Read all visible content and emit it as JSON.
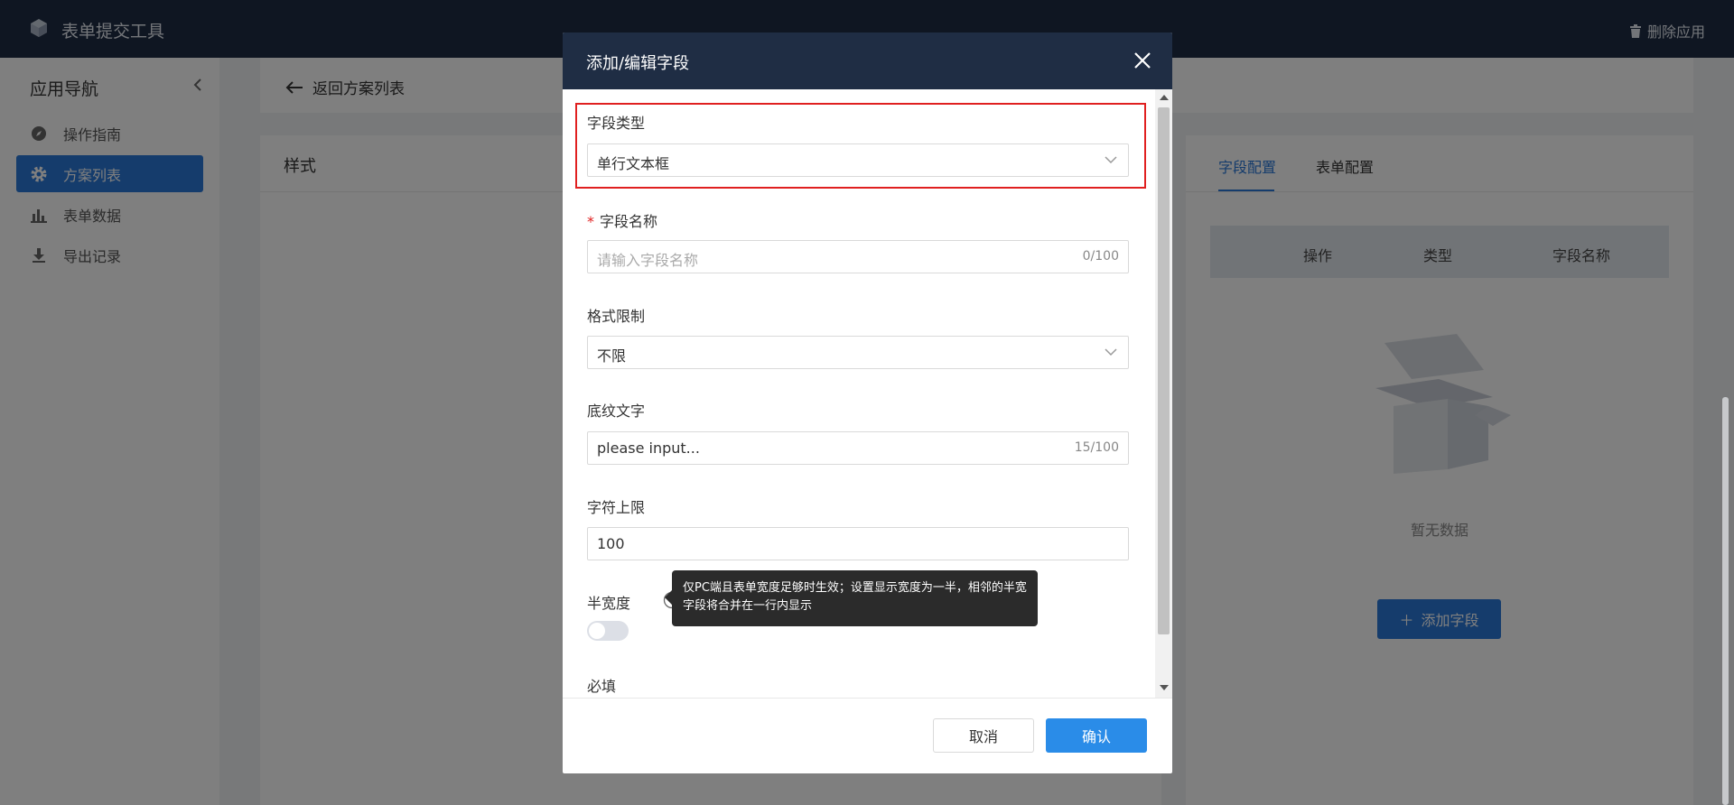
{
  "colors": {
    "brand": "#2a78d8",
    "topbar": "#1f2d44",
    "highlight": "#e02020",
    "confirm": "#2a8ce8"
  },
  "app": {
    "title": "表单提交工具",
    "delete_label": "删除应用"
  },
  "sidebar": {
    "header": "应用导航",
    "items": [
      {
        "label": "操作指南",
        "icon": "compass-icon",
        "active": false
      },
      {
        "label": "方案列表",
        "icon": "gear-icon",
        "active": true
      },
      {
        "label": "表单数据",
        "icon": "bar-chart-icon",
        "active": false
      },
      {
        "label": "导出记录",
        "icon": "download-icon",
        "active": false
      }
    ]
  },
  "back": {
    "label": "返回方案列表"
  },
  "style_panel": {
    "title": "样式"
  },
  "config_panel": {
    "tabs": [
      {
        "label": "字段配置",
        "active": true
      },
      {
        "label": "表单配置",
        "active": false
      }
    ],
    "table_headers": [
      "操作",
      "类型",
      "字段名称"
    ],
    "empty_text": "暂无数据",
    "add_field_label": "添加字段"
  },
  "modal": {
    "title": "添加/编辑字段",
    "fields": {
      "field_type": {
        "label": "字段类型",
        "value": "单行文本框"
      },
      "field_name": {
        "label": "字段名称",
        "required_mark": "*",
        "placeholder": "请输入字段名称",
        "count": "0/100"
      },
      "format": {
        "label": "格式限制",
        "value": "不限"
      },
      "placeholder_text": {
        "label": "底纹文字",
        "value": "please input...",
        "count": "15/100"
      },
      "max_chars": {
        "label": "字符上限",
        "value": "100"
      },
      "half_width": {
        "label": "半宽度",
        "enabled": false
      },
      "required": {
        "label": "必填"
      }
    },
    "tooltip": "仅PC端且表单宽度足够时生效；设置显示宽度为一半，相邻的半宽字段将合并在一行内显示",
    "cancel_label": "取消",
    "confirm_label": "确认"
  }
}
